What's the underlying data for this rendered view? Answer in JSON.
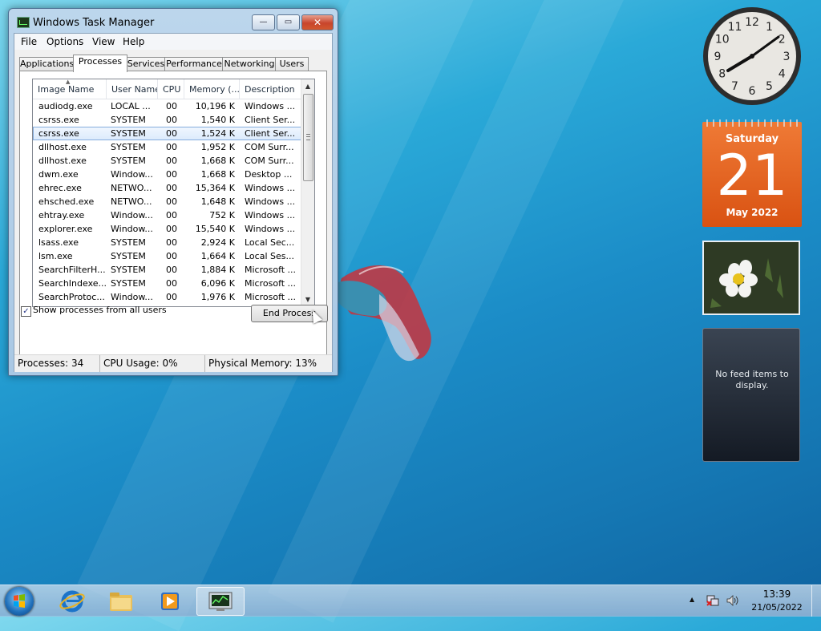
{
  "window": {
    "title": "Windows Task Manager",
    "controls": {
      "minimize": "—",
      "maximize": "▭",
      "close": "✕"
    }
  },
  "menu": [
    "File",
    "Options",
    "View",
    "Help"
  ],
  "tabs": [
    "Applications",
    "Processes",
    "Services",
    "Performance",
    "Networking",
    "Users"
  ],
  "active_tab": "Processes",
  "columns": [
    "Image Name",
    "User Name",
    "CPU",
    "Memory (...",
    "Description"
  ],
  "processes": [
    {
      "image": "audiodg.exe",
      "user": "LOCAL ...",
      "cpu": "00",
      "memory": "10,196 K",
      "desc": "Windows ..."
    },
    {
      "image": "csrss.exe",
      "user": "SYSTEM",
      "cpu": "00",
      "memory": "1,540 K",
      "desc": "Client Ser..."
    },
    {
      "image": "csrss.exe",
      "user": "SYSTEM",
      "cpu": "00",
      "memory": "1,524 K",
      "desc": "Client Ser...",
      "selected": true
    },
    {
      "image": "dllhost.exe",
      "user": "SYSTEM",
      "cpu": "00",
      "memory": "1,952 K",
      "desc": "COM Surr..."
    },
    {
      "image": "dllhost.exe",
      "user": "SYSTEM",
      "cpu": "00",
      "memory": "1,668 K",
      "desc": "COM Surr..."
    },
    {
      "image": "dwm.exe",
      "user": "Window...",
      "cpu": "00",
      "memory": "1,668 K",
      "desc": "Desktop ..."
    },
    {
      "image": "ehrec.exe",
      "user": "NETWO...",
      "cpu": "00",
      "memory": "15,364 K",
      "desc": "Windows ..."
    },
    {
      "image": "ehsched.exe",
      "user": "NETWO...",
      "cpu": "00",
      "memory": "1,648 K",
      "desc": "Windows ..."
    },
    {
      "image": "ehtray.exe",
      "user": "Window...",
      "cpu": "00",
      "memory": "752 K",
      "desc": "Windows ..."
    },
    {
      "image": "explorer.exe",
      "user": "Window...",
      "cpu": "00",
      "memory": "15,540 K",
      "desc": "Windows ..."
    },
    {
      "image": "lsass.exe",
      "user": "SYSTEM",
      "cpu": "00",
      "memory": "2,924 K",
      "desc": "Local Sec..."
    },
    {
      "image": "lsm.exe",
      "user": "SYSTEM",
      "cpu": "00",
      "memory": "1,664 K",
      "desc": "Local Ses..."
    },
    {
      "image": "SearchFilterH...",
      "user": "SYSTEM",
      "cpu": "00",
      "memory": "1,884 K",
      "desc": "Microsoft ..."
    },
    {
      "image": "SearchIndexe...",
      "user": "SYSTEM",
      "cpu": "00",
      "memory": "6,096 K",
      "desc": "Microsoft ..."
    },
    {
      "image": "SearchProtoc...",
      "user": "Window...",
      "cpu": "00",
      "memory": "1,976 K",
      "desc": "Microsoft ..."
    }
  ],
  "show_all_users": {
    "label": "Show processes from all users",
    "checked": true,
    "mark": "✓"
  },
  "end_process_label": "End Process",
  "status": {
    "processes": "Processes: 34",
    "cpu": "CPU Usage: 0%",
    "memory": "Physical Memory: 13%"
  },
  "gadgets": {
    "clock_numbers": [
      "12",
      "1",
      "2",
      "3",
      "4",
      "5",
      "6",
      "7",
      "8",
      "9",
      "10",
      "11"
    ],
    "calendar": {
      "day": "Saturday",
      "date": "21",
      "month": "May 2022"
    },
    "feed": "No feed items to display."
  },
  "taskbar": {
    "time": "13:39",
    "date": "21/05/2022",
    "tray_arrow": "▲",
    "icons": [
      "windows-start-icon",
      "internet-explorer-icon",
      "windows-explorer-icon",
      "media-player-icon",
      "task-manager-icon"
    ]
  },
  "colors": {
    "selected_row": "#dbeafc",
    "calendar_orange": "#d95212",
    "close_button": "#c8452c"
  }
}
